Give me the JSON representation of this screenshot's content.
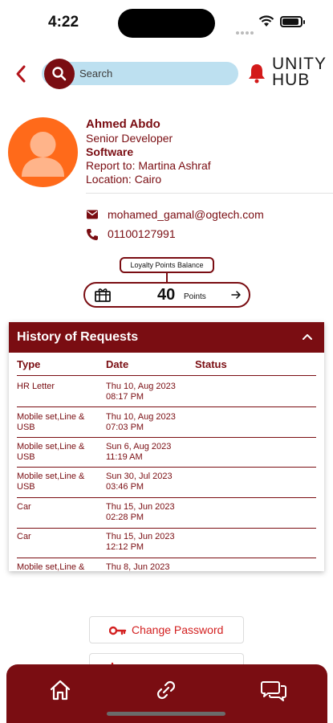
{
  "status_bar": {
    "time": "4:22"
  },
  "header": {
    "search_placeholder": "Search",
    "logo_line1": "UNITY",
    "logo_line2": "HUB"
  },
  "profile": {
    "name": "Ahmed Abdo",
    "title": "Senior Developer",
    "department": "Software",
    "report_to": "Report to: Martina Ashraf",
    "location": "Location: Cairo"
  },
  "contact": {
    "email": "mohamed_gamal@ogtech.com",
    "phone": "01100127991"
  },
  "loyalty": {
    "label": "Loyalty Points Balance",
    "points": "40",
    "unit": "Points"
  },
  "history": {
    "title": "History of Requests",
    "columns": [
      "Type",
      "Date",
      "Status"
    ],
    "rows": [
      {
        "type": "HR Letter",
        "date": "Thu 10, Aug 2023",
        "time": "08:17 PM",
        "status": ""
      },
      {
        "type": "Mobile set,Line &",
        "type2": "USB",
        "date": "Thu 10, Aug 2023",
        "time": "07:03 PM",
        "status": ""
      },
      {
        "type": "Mobile set,Line &",
        "type2": "USB",
        "date": "Sun 6, Aug 2023",
        "time": "11:19 AM",
        "status": ""
      },
      {
        "type": "Mobile set,Line &",
        "type2": "USB",
        "date": "Sun 30, Jul 2023",
        "time": "03:46 PM",
        "status": ""
      },
      {
        "type": "Car",
        "date": "Thu 15, Jun 2023",
        "time": "02:28 PM",
        "status": ""
      },
      {
        "type": "Car",
        "date": "Thu 15, Jun 2023",
        "time": "12:12 PM",
        "status": ""
      },
      {
        "type": "Mobile set,Line &",
        "date": "Thu 8, Jun 2023",
        "status": ""
      }
    ]
  },
  "actions": {
    "change_password": "Change Password"
  },
  "colors": {
    "brand": "#7a0d12",
    "search_bg": "#bde0f0",
    "avatar_bg": "#ff6a1a",
    "action_red": "#d32020"
  },
  "icons": {
    "back": "chevron-left-icon",
    "search": "search-icon",
    "bell": "bell-icon",
    "email": "email-icon",
    "phone": "phone-icon",
    "gift": "gift-card-icon",
    "arrow": "arrow-right-icon",
    "collapse": "chevron-up-icon",
    "key": "key-icon",
    "home": "home-icon",
    "link": "link-icon",
    "chat": "chat-icon"
  }
}
